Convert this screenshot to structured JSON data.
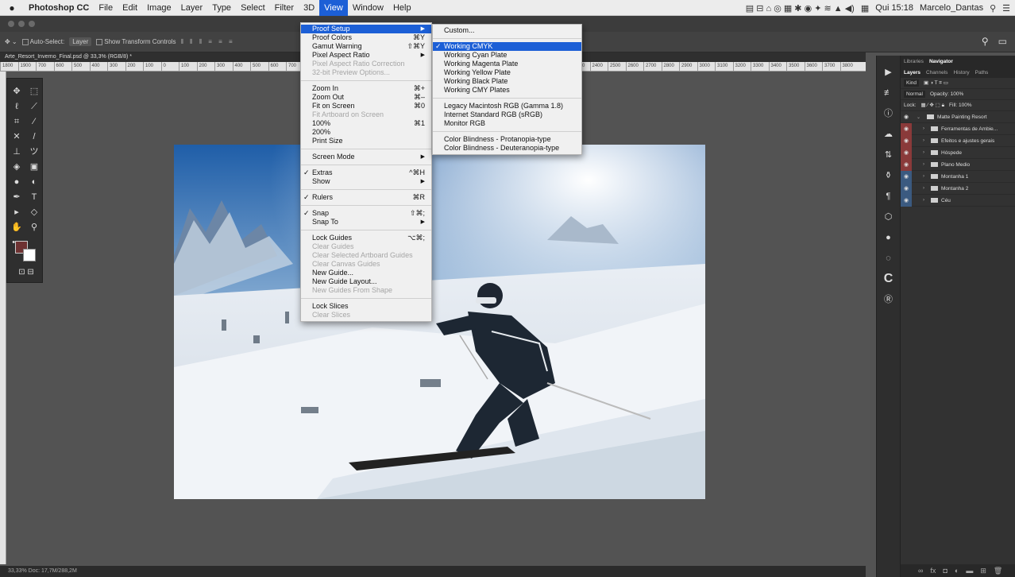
{
  "menubar": {
    "app": "Photoshop CC",
    "items": [
      "File",
      "Edit",
      "Image",
      "Layer",
      "Type",
      "Select",
      "Filter",
      "3D",
      "View",
      "Window",
      "Help"
    ],
    "clock": "Qui 15:18",
    "user": "Marcelo_Dantas"
  },
  "options": {
    "auto_select": "Auto-Select:",
    "auto_select_value": "Layer",
    "transform": "Show Transform Controls"
  },
  "document": {
    "tab_title": "Arte_Resort_Inverno_Final.psd @ 33,3% (RGB/8) *",
    "ruler_ticks": [
      "1800",
      "1900",
      "700",
      "600",
      "500",
      "400",
      "300",
      "200",
      "100",
      "0",
      "100",
      "200",
      "300",
      "400",
      "500",
      "600",
      "700",
      "800",
      "900",
      "1000",
      "1100",
      "1200",
      "1300",
      "1400",
      "1500",
      "1600",
      "1700",
      "1800",
      "1900",
      "2000",
      "2100",
      "2200",
      "2300",
      "2400",
      "2500",
      "2600",
      "2700",
      "2800",
      "2900",
      "3000",
      "3100",
      "3200",
      "3300",
      "3400",
      "3500",
      "3600",
      "3700",
      "3800"
    ],
    "status": "33,33%      Doc: 17,7M/288,2M"
  },
  "view_menu": {
    "items": [
      {
        "label": "Proof Setup",
        "shortcut": "",
        "submenu": true,
        "disabled": false,
        "check": false,
        "highlighted": true
      },
      {
        "label": "Proof Colors",
        "shortcut": "⌘Y"
      },
      {
        "label": "Gamut Warning",
        "shortcut": "⇧⌘Y"
      },
      {
        "label": "Pixel Aspect Ratio",
        "shortcut": "",
        "submenu": true
      },
      {
        "label": "Pixel Aspect Ratio Correction",
        "disabled": true
      },
      {
        "label": "32-bit Preview Options...",
        "disabled": true
      },
      {
        "sep": true
      },
      {
        "label": "Zoom In",
        "shortcut": "⌘+"
      },
      {
        "label": "Zoom Out",
        "shortcut": "⌘–"
      },
      {
        "label": "Fit on Screen",
        "shortcut": "⌘0"
      },
      {
        "label": "Fit Artboard on Screen",
        "disabled": true
      },
      {
        "label": "100%",
        "shortcut": "⌘1"
      },
      {
        "label": "200%"
      },
      {
        "label": "Print Size"
      },
      {
        "sep": true
      },
      {
        "label": "Screen Mode",
        "submenu": true
      },
      {
        "sep": true
      },
      {
        "label": "Extras",
        "shortcut": "^⌘H",
        "check": true
      },
      {
        "label": "Show",
        "submenu": true
      },
      {
        "sep": true
      },
      {
        "label": "Rulers",
        "shortcut": "⌘R",
        "check": true
      },
      {
        "sep": true
      },
      {
        "label": "Snap",
        "shortcut": "⇧⌘;",
        "check": true
      },
      {
        "label": "Snap To",
        "submenu": true
      },
      {
        "sep": true
      },
      {
        "label": "Lock Guides",
        "shortcut": "⌥⌘;"
      },
      {
        "label": "Clear Guides",
        "disabled": true
      },
      {
        "label": "Clear Selected Artboard Guides",
        "disabled": true
      },
      {
        "label": "Clear Canvas Guides",
        "disabled": true
      },
      {
        "label": "New Guide..."
      },
      {
        "label": "New Guide Layout..."
      },
      {
        "label": "New Guides From Shape",
        "disabled": true
      },
      {
        "sep": true
      },
      {
        "label": "Lock Slices"
      },
      {
        "label": "Clear Slices",
        "disabled": true
      }
    ]
  },
  "proof_menu": {
    "items": [
      {
        "label": "Custom..."
      },
      {
        "sep": true
      },
      {
        "label": "Working CMYK",
        "check": true,
        "highlighted": true
      },
      {
        "label": "Working Cyan Plate"
      },
      {
        "label": "Working Magenta Plate"
      },
      {
        "label": "Working Yellow Plate"
      },
      {
        "label": "Working Black Plate"
      },
      {
        "label": "Working CMY Plates"
      },
      {
        "sep": true
      },
      {
        "label": "Legacy Macintosh RGB (Gamma 1.8)"
      },
      {
        "label": "Internet Standard RGB (sRGB)"
      },
      {
        "label": "Monitor RGB"
      },
      {
        "sep": true
      },
      {
        "label": "Color Blindness - Protanopia-type"
      },
      {
        "label": "Color Blindness - Deuteranopia-type"
      }
    ]
  },
  "panels": {
    "top_tabs": [
      "Libraries",
      "Navigator"
    ],
    "tabs": [
      "Layers",
      "Channels",
      "History",
      "Paths"
    ],
    "kind": "Kind",
    "blend": "Normal",
    "opacity": "Opacity: 100%",
    "lock": "Lock:",
    "fill": "Fill: 100%",
    "group": "Matte Painting Resort",
    "layers": [
      {
        "name": "Ferramentas de Ambie...",
        "eye": "red"
      },
      {
        "name": "Efeitos e ajustes gerais",
        "eye": "red"
      },
      {
        "name": "Hóspede",
        "eye": "red"
      },
      {
        "name": "Plano Medio",
        "eye": "red"
      },
      {
        "name": "Montanha 1",
        "eye": "blue"
      },
      {
        "name": "Montanha 2",
        "eye": "blue"
      },
      {
        "name": "Céu",
        "eye": "blue"
      }
    ]
  },
  "colors": {
    "accent": "#1c5fd6",
    "foreground": "#6e3232",
    "background": "#ffffff"
  }
}
